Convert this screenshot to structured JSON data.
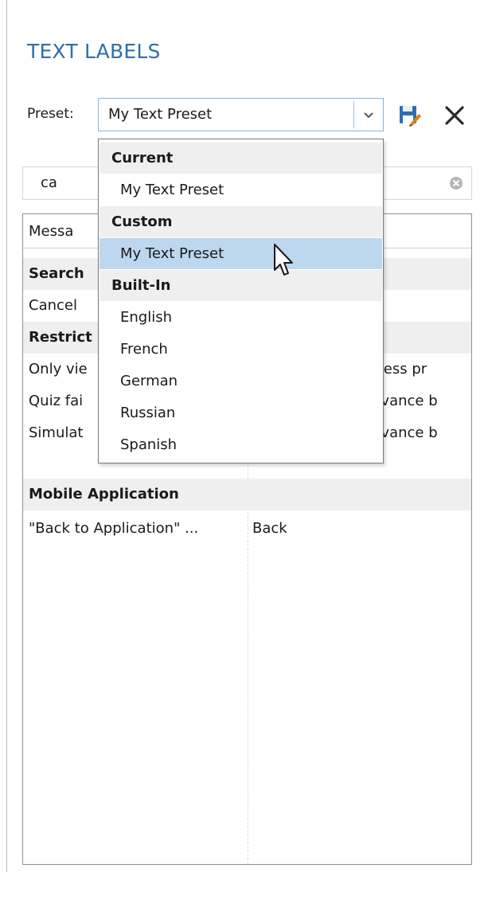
{
  "panel": {
    "title": "TEXT LABELS"
  },
  "preset": {
    "label": "Preset:",
    "selected_value": "My Text Preset",
    "dropdown": {
      "groups": [
        {
          "name": "Current",
          "items": [
            "My Text Preset"
          ]
        },
        {
          "name": "Custom",
          "items": [
            "My Text Preset"
          ]
        },
        {
          "name": "Built-In",
          "items": [
            "English",
            "French",
            "German",
            "Russian",
            "Spanish"
          ]
        }
      ],
      "highlighted_group": "Custom",
      "highlighted_item": "My Text Preset"
    }
  },
  "toolbar": {
    "save_icon": "save-preset-icon",
    "close_icon": "close-icon"
  },
  "search": {
    "value": "ca",
    "clear_icon": "clear-search-icon"
  },
  "grid": {
    "header": [
      "Messa",
      ""
    ],
    "rows": [
      {
        "type": "group",
        "c1": "Search",
        "c2": ""
      },
      {
        "type": "item",
        "c1": "Cancel",
        "c2": ""
      },
      {
        "type": "group",
        "c1": "Restrict",
        "c2": ""
      },
      {
        "type": "item",
        "c1": "Only vie",
        "c2": "ccess pr"
      },
      {
        "type": "item",
        "c1": "Quiz fai",
        "c2": "dvance b"
      },
      {
        "type": "item",
        "c1": "Simulat",
        "c2": "dvance b"
      },
      {
        "type": "group",
        "c1": "Mobile Application",
        "c2": ""
      },
      {
        "type": "item",
        "c1": "\"Back to Application\" ...",
        "c2": "Back"
      }
    ]
  },
  "colors": {
    "title": "#2e6fad",
    "selection": "#bdd7ee",
    "group_bg": "#efefef",
    "combo_border": "#8ab4dc"
  }
}
